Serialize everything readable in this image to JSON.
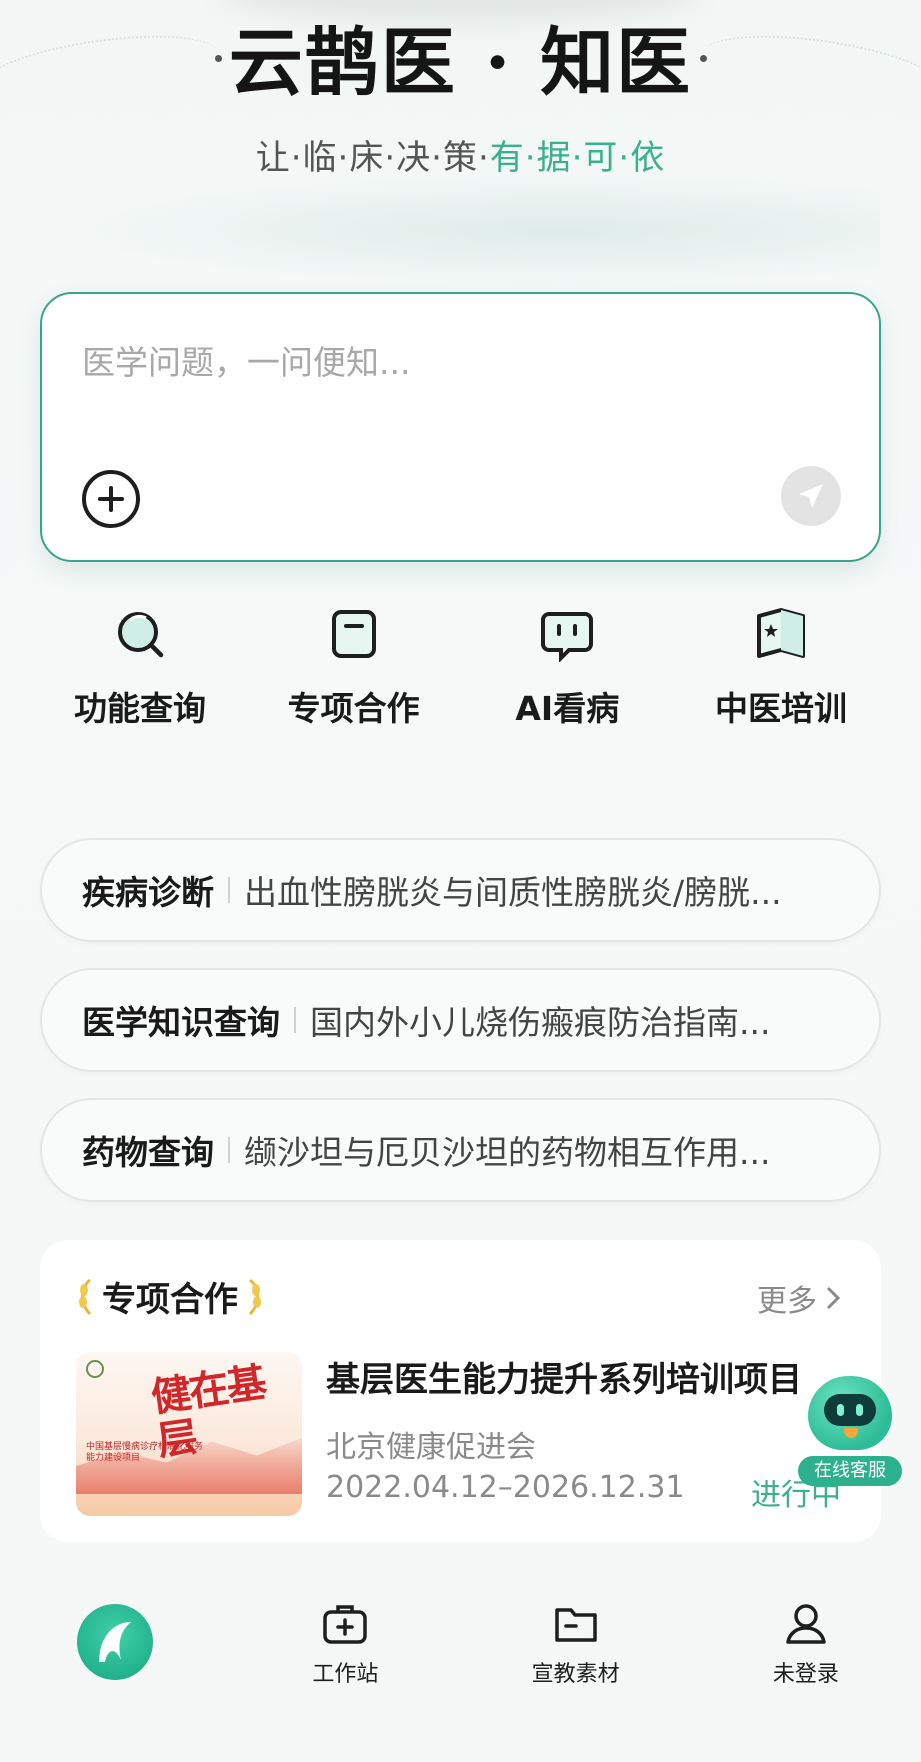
{
  "header": {
    "title": "云鹊医 · 知医",
    "tagline_plain": "让·临·床·决·策·",
    "tagline_accent": "有·据·可·依"
  },
  "search": {
    "placeholder": "医学问题，一问便知..."
  },
  "quick_actions": [
    {
      "label": "功能查询",
      "icon": "magnifier-icon"
    },
    {
      "label": "专项合作",
      "icon": "bookmark-icon"
    },
    {
      "label": "AI看病",
      "icon": "chat-bot-icon"
    },
    {
      "label": "中医培训",
      "icon": "book-star-icon"
    }
  ],
  "suggestions": [
    {
      "category": "疾病诊断",
      "query": "出血性膀胱炎与间质性膀胱炎/膀胱..."
    },
    {
      "category": "医学知识查询",
      "query": "国内外小儿烧伤瘢痕防治指南..."
    },
    {
      "category": "药物查询",
      "query": "缬沙坦与厄贝沙坦的药物相互作用..."
    }
  ],
  "cooperation": {
    "title": "专项合作",
    "more_label": "更多",
    "item": {
      "name": "基层医生能力提升系列培训项目",
      "organizer": "北京健康促进会",
      "date_range": "2022.04.12–2026.12.31",
      "status": "进行中",
      "thumb_calligraphy": "健在基层",
      "thumb_caption": "中国基层慢病诊疗标准化服务能力建设项目"
    }
  },
  "service_bot": {
    "label": "在线客服"
  },
  "tabbar": {
    "items": [
      {
        "label": "",
        "icon": "home-logo-icon"
      },
      {
        "label": "工作站",
        "icon": "medical-kit-icon"
      },
      {
        "label": "宣教素材",
        "icon": "folder-icon"
      },
      {
        "label": "未登录",
        "icon": "user-icon"
      }
    ]
  },
  "colors": {
    "accent": "#3bb08f",
    "border_green": "#3aa488",
    "status_green": "#3bb08f"
  }
}
